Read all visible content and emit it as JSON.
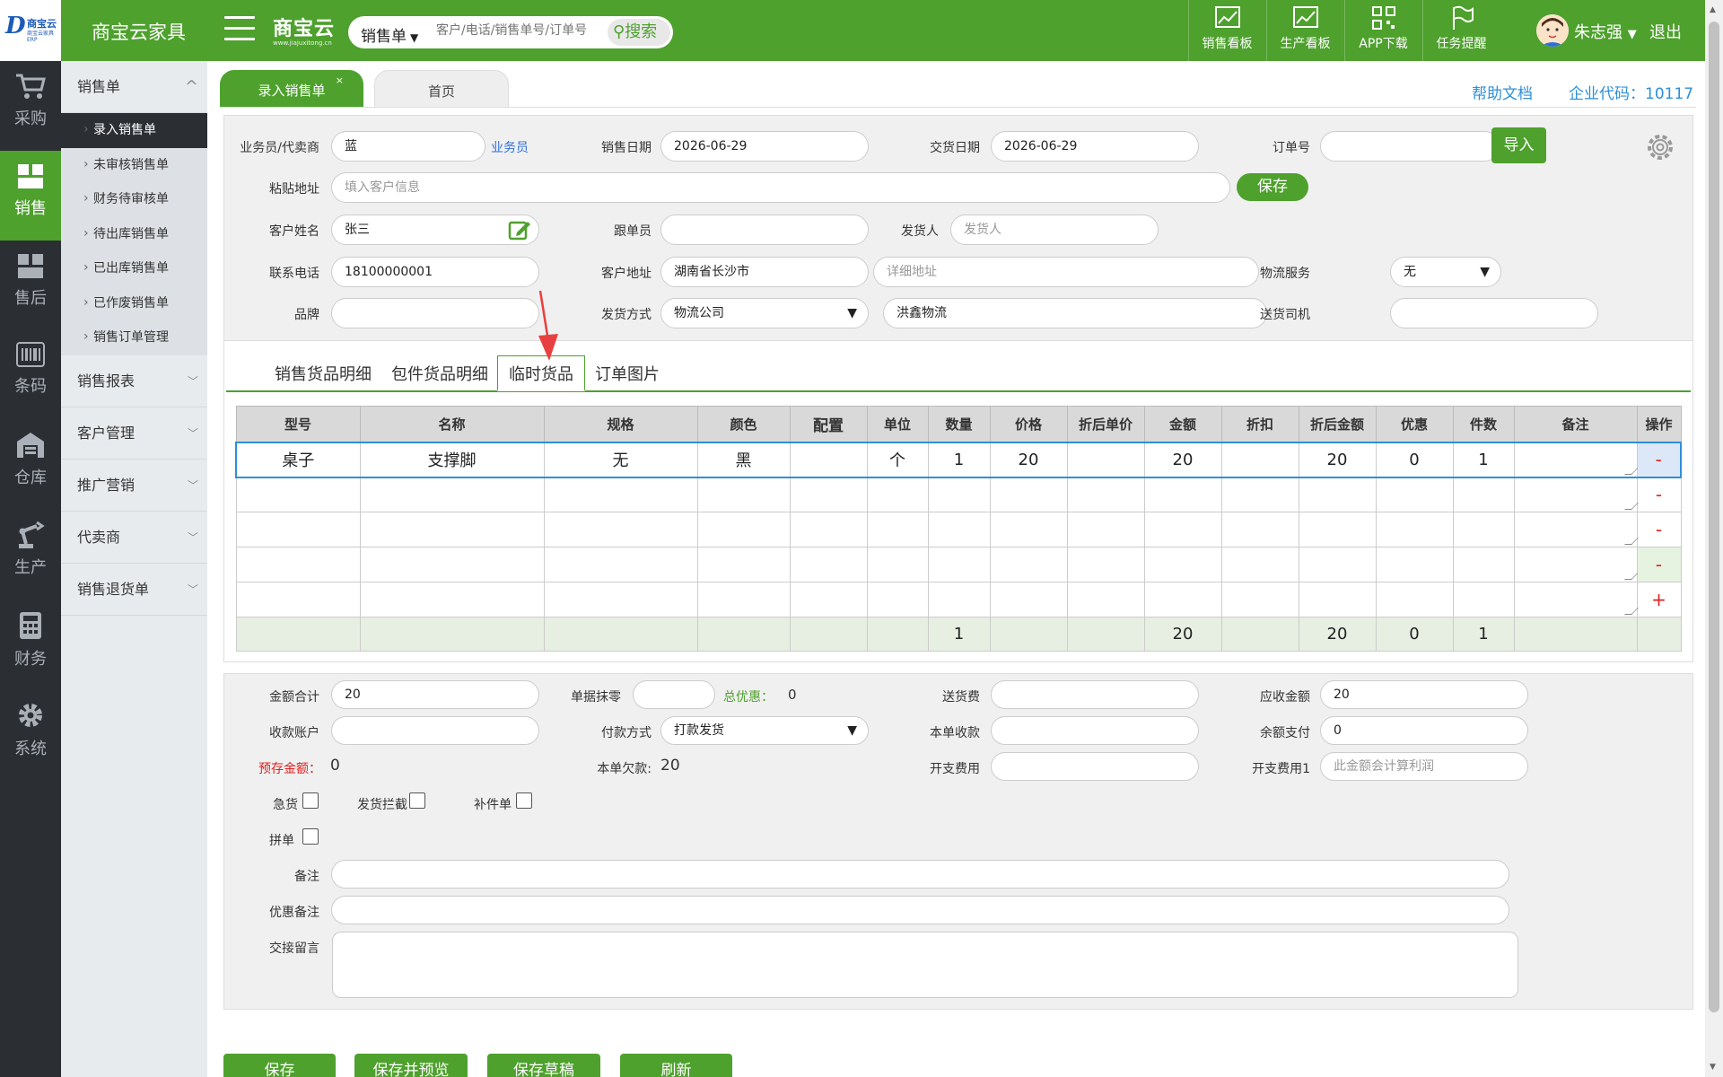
{
  "topbar": {
    "logo_mark": "D",
    "logo_name": "商宝云",
    "logo_sub": "商宝云家具ERP",
    "company": "商宝云家具",
    "brand": "商宝云",
    "brand_url": "www.jiajuxitong.cn",
    "search_type": "销售单",
    "search_placeholder": "客户/电话/销售单号/订单号",
    "search_button": "搜索",
    "nav": [
      "销售看板",
      "生产看板",
      "APP下载",
      "任务提醒"
    ],
    "user": "朱志强",
    "logout": "退出"
  },
  "leftbar": [
    "采购",
    "销售",
    "售后",
    "条码",
    "仓库",
    "生产",
    "财务",
    "系统"
  ],
  "menu": {
    "sales": "销售单",
    "sub": [
      "录入销售单",
      "未审核销售单",
      "财务待审核单",
      "待出库销售单",
      "已出库销售单",
      "已作废销售单",
      "销售订单管理"
    ],
    "groups": [
      "销售报表",
      "客户管理",
      "推广营销",
      "代卖商",
      "销售退货单"
    ]
  },
  "tabs": {
    "active": "录入销售单",
    "home": "首页",
    "close": "×"
  },
  "header_links": {
    "help": "帮助文档",
    "corp": "企业代码：10117"
  },
  "form": {
    "salesman_label": "业务员/代卖商",
    "salesman_value": "蓝",
    "salesman_link": "业务员",
    "sale_date_label": "销售日期",
    "sale_date": "2026-06-29",
    "delivery_date_label": "交货日期",
    "delivery_date": "2026-06-29",
    "order_no_label": "订单号",
    "import_btn": "导入",
    "paste_label": "粘贴地址",
    "paste_placeholder": "填入客户信息",
    "save_btn": "保存",
    "customer_label": "客户姓名",
    "customer": "张三",
    "follower_label": "跟单员",
    "shipper_label": "发货人",
    "shipper_placeholder": "发货人",
    "phone_label": "联系电话",
    "phone": "18100000001",
    "address_label": "客户地址",
    "address": "湖南省长沙市",
    "address_detail_placeholder": "详细地址",
    "logistics_label": "物流服务",
    "logistics": "无",
    "brand_label": "品牌",
    "ship_method_label": "发货方式",
    "ship_method": "物流公司",
    "ship_company": "洪鑫物流",
    "driver_label": "送货司机"
  },
  "subtabs": [
    "销售货品明细",
    "包件货品明细",
    "临时货品",
    "订单图片"
  ],
  "grid": {
    "headers": [
      "型号",
      "名称",
      "规格",
      "颜色",
      "配置",
      "单位",
      "数量",
      "价格",
      "折后单价",
      "金额",
      "折扣",
      "折后金额",
      "优惠",
      "件数",
      "备注",
      "操作"
    ],
    "row1": {
      "model": "桌子",
      "name": "支撑脚",
      "spec": "无",
      "color": "黑",
      "unit": "个",
      "qty": "1",
      "price": "20",
      "amount": "20",
      "disc_amount": "20",
      "discount": "0",
      "pieces": "1"
    },
    "minus": "-",
    "plus": "+",
    "sum": {
      "qty": "1",
      "amount": "20",
      "disc_amount": "20",
      "discount": "0",
      "pieces": "1"
    }
  },
  "bottom": {
    "total_label": "金额合计",
    "total": "20",
    "round_label": "单据抹零",
    "total_discount_label": "总优惠：",
    "total_discount": "0",
    "delivery_fee_label": "送货费",
    "receivable_label": "应收金额",
    "receivable": "20",
    "account_label": "收款账户",
    "pay_method_label": "付款方式",
    "pay_method": "打款发货",
    "this_receipt_label": "本单收款",
    "balance_pay_label": "余额支付",
    "balance_pay": "0",
    "prepaid_label": "预存金额：",
    "prepaid": "0",
    "owed_label": "本单欠款:",
    "owed": "20",
    "expense_label": "开支费用",
    "expense1_label": "开支费用1",
    "expense1_placeholder": "此金额会计算利润",
    "urgent": "急货",
    "intercept": "发货拦截",
    "supplement": "补件单",
    "merge": "拼单",
    "remark_label": "备注",
    "discount_remark_label": "优惠备注",
    "handover_label": "交接留言"
  },
  "buttons": [
    "保存",
    "保存并预览",
    "保存草稿",
    "刷新"
  ],
  "colors": {
    "primary": "#4ea12d",
    "link": "#2f8fd8",
    "danger": "#e02020",
    "sidebar": "#2b2e33"
  }
}
